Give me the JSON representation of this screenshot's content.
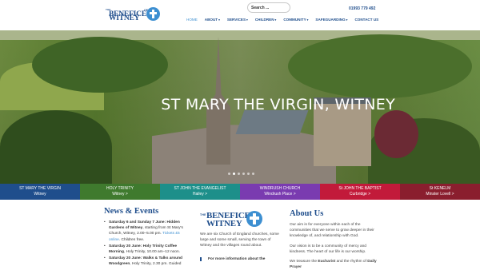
{
  "header": {
    "logo": {
      "the": "THE",
      "line1": "BENEFICE",
      "of": "OF",
      "line2": "WITNEY"
    },
    "search_placeholder": "Search ...",
    "phone": "01993 779 492"
  },
  "nav": {
    "items": [
      {
        "label": "HOME",
        "caret": false,
        "active": true
      },
      {
        "label": "ABOUT",
        "caret": true
      },
      {
        "label": "SERVICES",
        "caret": true
      },
      {
        "label": "CHILDREN",
        "caret": true
      },
      {
        "label": "COMMUNITY",
        "caret": true
      },
      {
        "label": "SAFEGUARDING",
        "caret": true
      },
      {
        "label": "CONTACT US",
        "caret": false
      }
    ],
    "caret_glyph": "▾"
  },
  "hero": {
    "title": "ST MARY THE VIRGIN, WITNEY",
    "slides": 6,
    "active_slide": 1
  },
  "tabs": [
    {
      "name": "ST MARY THE VIRGIN",
      "place": "Witney",
      "color": "#1f4e8c"
    },
    {
      "name": "HOLY TRINITY",
      "place": "Witney  >",
      "color": "#3f7a2e"
    },
    {
      "name": "ST JOHN THE EVANGELIST",
      "place": "Hailey  >",
      "color": "#1d8f8a"
    },
    {
      "name": "WINDRUSH CHURCH",
      "place": "Windrush Place  >",
      "color": "#7a3bb0"
    },
    {
      "name": "St JOHN THE BAPTIST",
      "place": "Curbridge  >",
      "color": "#c21a3a"
    },
    {
      "name": "St KENELM",
      "place": "Minster Lovell  >",
      "color": "#8a1e2e"
    }
  ],
  "news": {
    "title": "News & Events",
    "items": [
      {
        "bold": "Saturday 6 and Sunday 7 June: Hidden Gardens of Witney",
        "text": ", starting from St Mary's Church, Witney, 2.00–5.00 pm. ",
        "link": "Tickets £5 online",
        "tail": ". Children free."
      },
      {
        "bold": "Saturday 20 June: Holy Trinity Coffee Morning",
        "text": ", Holy Trinity, 10.00 am–12 noon.",
        "link": "",
        "tail": ""
      },
      {
        "bold": "Saturday 20 June: Walks & Talks around Woodgreen",
        "text": ", Holy Trinity, 2.30 pm. Guided",
        "link": "",
        "tail": ""
      }
    ]
  },
  "intro": {
    "logo": {
      "the": "THE",
      "line1": "BENEFICE",
      "of": "OF",
      "line2": "WITNEY"
    },
    "text": "We are six Church of England churches, some large and some small, serving the town of Witney and the villages round about.",
    "more": "For more information about the"
  },
  "about": {
    "title": "About Us",
    "p1": "Our aim is for everyone within each of the communities that we serve to grow deeper in their knowledge of, and relationship with God.",
    "p2": "Our vision is to be a community of mercy and kindness. The heart of our life is our worship.",
    "p3_pre": "We treasure the ",
    "p3_bold": "Eucharist",
    "p3_mid": " and the rhythm of ",
    "p3_bold2": "Daily Prayer"
  }
}
